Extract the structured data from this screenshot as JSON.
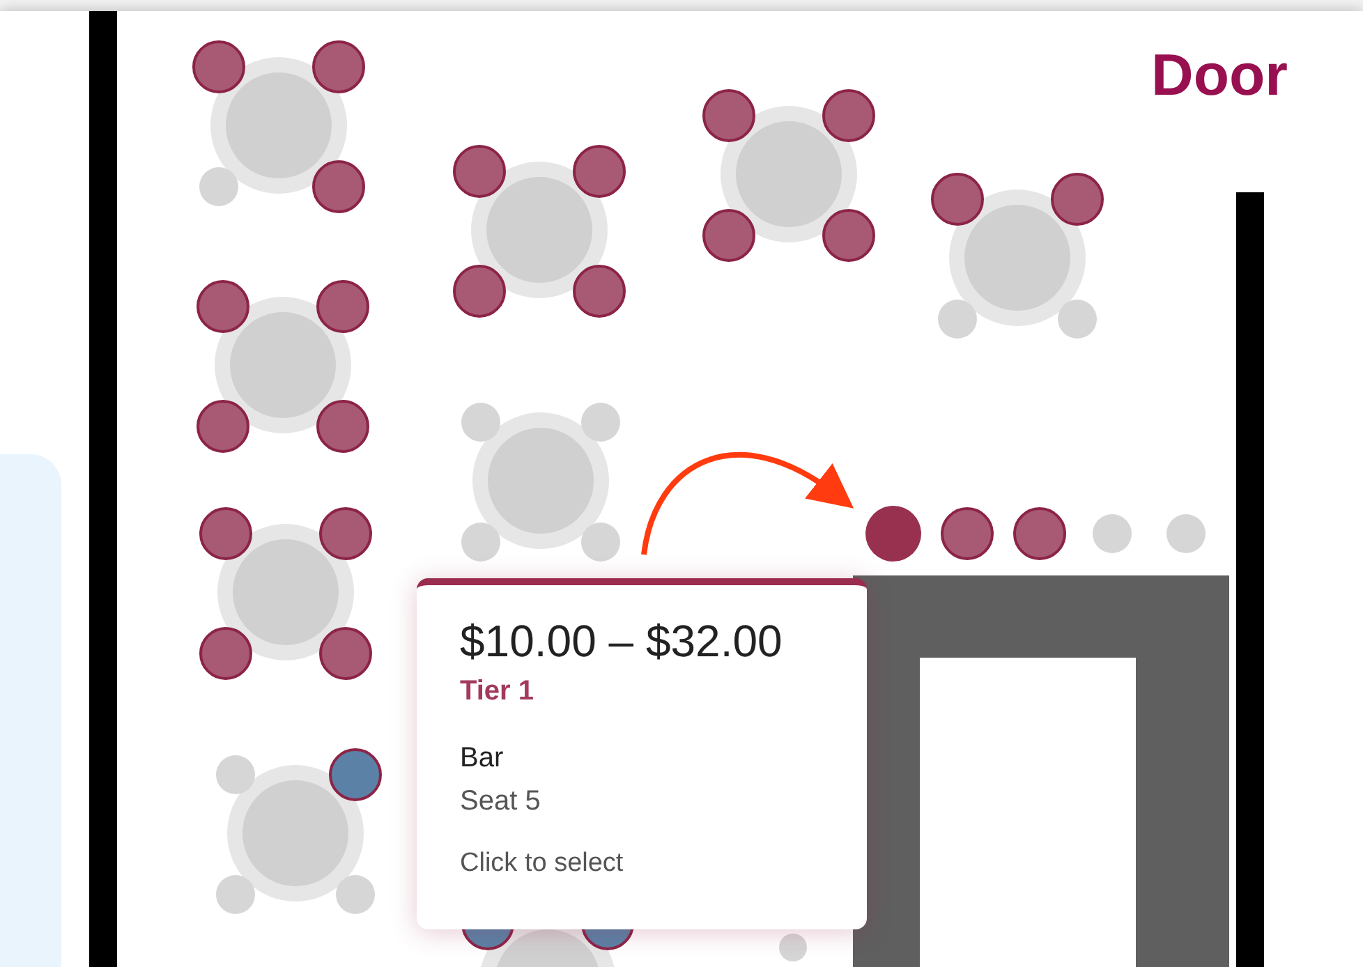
{
  "map": {
    "door_label": "Door",
    "tables": [
      {
        "seats": [
          {
            "kind": "available",
            "color": "#a85a75"
          },
          {
            "kind": "available",
            "color": "#a85a75"
          },
          {
            "kind": "unavailable"
          },
          {
            "kind": "available",
            "color": "#a85a75"
          }
        ]
      },
      {
        "seats": [
          {
            "kind": "available",
            "color": "#a85a75"
          },
          {
            "kind": "available",
            "color": "#a85a75"
          },
          {
            "kind": "available",
            "color": "#a85a75"
          },
          {
            "kind": "available",
            "color": "#a85a75"
          }
        ]
      },
      {
        "seats": [
          {
            "kind": "available",
            "color": "#a85a75"
          },
          {
            "kind": "available",
            "color": "#a85a75"
          },
          {
            "kind": "available",
            "color": "#a85a75"
          },
          {
            "kind": "available",
            "color": "#a85a75"
          }
        ]
      },
      {
        "seats": [
          {
            "kind": "available",
            "color": "#a85a75"
          },
          {
            "kind": "available",
            "color": "#a85a75"
          },
          {
            "kind": "unavailable"
          },
          {
            "kind": "unavailable"
          }
        ]
      },
      {
        "seats": [
          {
            "kind": "available",
            "color": "#a85a75"
          },
          {
            "kind": "available",
            "color": "#a85a75"
          },
          {
            "kind": "available",
            "color": "#a85a75"
          },
          {
            "kind": "available",
            "color": "#a85a75"
          }
        ]
      },
      {
        "seats": [
          {
            "kind": "unavailable"
          },
          {
            "kind": "unavailable"
          },
          {
            "kind": "unavailable"
          },
          {
            "kind": "unavailable"
          }
        ]
      },
      {
        "seats": [
          {
            "kind": "available",
            "color": "#a85a75"
          },
          {
            "kind": "available",
            "color": "#a85a75"
          },
          {
            "kind": "available",
            "color": "#a85a75"
          },
          {
            "kind": "available",
            "color": "#a85a75"
          }
        ]
      },
      {
        "seats": [
          {
            "kind": "unavailable"
          },
          {
            "kind": "available",
            "color": "#5b82a6"
          },
          {
            "kind": "unavailable"
          },
          {
            "kind": "unavailable"
          }
        ]
      },
      {
        "seats": [
          {
            "kind": "available",
            "color": "#5b82a6"
          },
          {
            "kind": "available",
            "color": "#5b82a6"
          }
        ]
      }
    ],
    "bar_seats": [
      {
        "kind": "available",
        "color": "#98304f",
        "hovered": true
      },
      {
        "kind": "available",
        "color": "#a85a75",
        "hovered": false
      },
      {
        "kind": "available",
        "color": "#a85a75",
        "hovered": false
      },
      {
        "kind": "unavailable",
        "hovered": false
      },
      {
        "kind": "unavailable",
        "hovered": false
      }
    ]
  },
  "tooltip": {
    "price": "$10.00 – $32.00",
    "tier": "Tier 1",
    "section": "Bar",
    "seat": "Seat 5",
    "hint": "Click to select"
  }
}
